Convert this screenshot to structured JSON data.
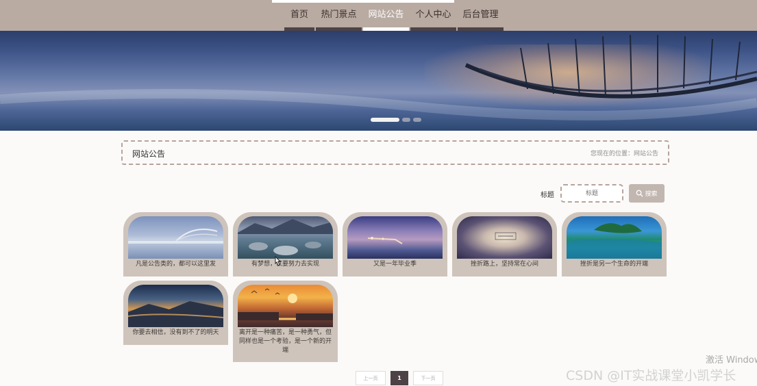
{
  "nav": {
    "items": [
      {
        "label": "首页",
        "active": false
      },
      {
        "label": "热门景点",
        "active": false
      },
      {
        "label": "网站公告",
        "active": true
      },
      {
        "label": "个人中心",
        "active": false
      },
      {
        "label": "后台管理",
        "active": false
      }
    ]
  },
  "carousel": {
    "slide_count": 3,
    "active_index": 0
  },
  "breadcrumb": {
    "title": "网站公告",
    "location": "您现在的位置：网站公告"
  },
  "search": {
    "label": "标题",
    "placeholder": "标题",
    "button_label": "搜索"
  },
  "notices": [
    {
      "caption": "凡是公告类的，都可以这里发"
    },
    {
      "caption": "有梦想，就要努力去实现"
    },
    {
      "caption": "又是一年毕业季"
    },
    {
      "caption": "挫折路上，坚持常在心间"
    },
    {
      "caption": "挫折是另一个生命的开端"
    },
    {
      "caption": "你要去相信，没有到不了的明天"
    },
    {
      "caption": "离开是一种痛苦，是一种勇气，但同样也是一个考验，是一个新的开端"
    }
  ],
  "pager": {
    "prev": "上一页",
    "current": "1",
    "next": "下一页"
  },
  "watermarks": {
    "activate": "激活 Window",
    "csdn": "CSDN @IT实战课堂小凯学长"
  },
  "colors": {
    "nav_bg": "#b9aaa2",
    "nav_tab_bar": "#4d4346",
    "card_bg": "#cec4bb",
    "accent_dashed": "#b6a39d",
    "search_btn": "#c2b7b0"
  }
}
